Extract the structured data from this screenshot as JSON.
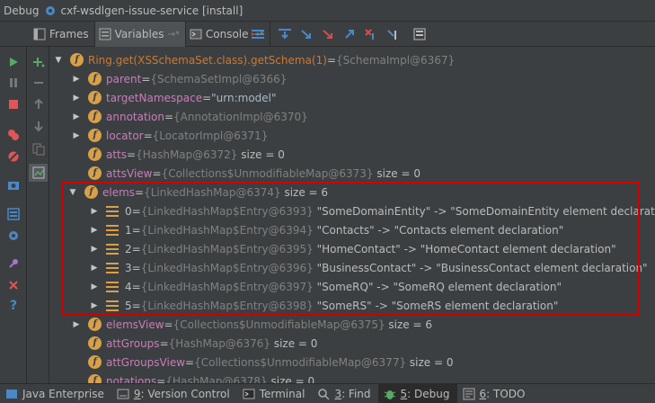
{
  "title": {
    "label": "Debug",
    "config": "cxf-wsdlgen-issue-service [install]"
  },
  "tabs": [
    {
      "label": "Frames"
    },
    {
      "label": "Variables",
      "pin": "→*"
    },
    {
      "label": "Console",
      "pin": "→*"
    }
  ],
  "tree": {
    "root": {
      "name": "Ring.get(XSSchemaSet.class).getSchema(1)",
      "eq": " = ",
      "value": "{SchemaImpl@6367}"
    },
    "fields": [
      {
        "name": "parent",
        "eq": " = ",
        "ref": "{SchemaSetImpl@6366}",
        "extra": ""
      },
      {
        "name": "targetNamespace",
        "eq": " = ",
        "ref": "",
        "extra": "\"urn:model\""
      },
      {
        "name": "annotation",
        "eq": " = ",
        "ref": "{AnnotationImpl@6370}",
        "extra": ""
      },
      {
        "name": "locator",
        "eq": " = ",
        "ref": "{LocatorImpl@6371}",
        "extra": ""
      },
      {
        "name": "atts",
        "eq": " = ",
        "ref": "{HashMap@6372}",
        "extra": "size = 0"
      },
      {
        "name": "attsView",
        "eq": " = ",
        "ref": "{Collections$UnmodifiableMap@6373}",
        "extra": "size = 0"
      },
      {
        "name": "elems",
        "eq": " = ",
        "ref": "{LinkedHashMap@6374}",
        "extra": "size = 6"
      }
    ],
    "entries": [
      {
        "index": "0",
        "ref": "{LinkedHashMap$Entry@6393}",
        "value": "\"SomeDomainEntity\" -> \"SomeDomainEntity element declaration\""
      },
      {
        "index": "1",
        "ref": "{LinkedHashMap$Entry@6394}",
        "value": "\"Contacts\" -> \"Contacts element declaration\""
      },
      {
        "index": "2",
        "ref": "{LinkedHashMap$Entry@6395}",
        "value": "\"HomeContact\" -> \"HomeContact element declaration\""
      },
      {
        "index": "3",
        "ref": "{LinkedHashMap$Entry@6396}",
        "value": "\"BusinessContact\" -> \"BusinessContact element declaration\""
      },
      {
        "index": "4",
        "ref": "{LinkedHashMap$Entry@6397}",
        "value": "\"SomeRQ\" -> \"SomeRQ element declaration\""
      },
      {
        "index": "5",
        "ref": "{LinkedHashMap$Entry@6398}",
        "value": "\"SomeRS\" -> \"SomeRS element declaration\""
      }
    ],
    "after": [
      {
        "name": "elemsView",
        "eq": " = ",
        "ref": "{Collections$UnmodifiableMap@6375}",
        "extra": "size = 6"
      },
      {
        "name": "attGroups",
        "eq": " = ",
        "ref": "{HashMap@6376}",
        "extra": "size = 0"
      },
      {
        "name": "attGroupsView",
        "eq": " = ",
        "ref": "{Collections$UnmodifiableMap@6377}",
        "extra": "size = 0"
      },
      {
        "name": "notations",
        "eq": " = ",
        "ref": "{HashMap@6378}",
        "extra": "size = 0"
      }
    ]
  },
  "status": [
    {
      "key": "",
      "label": "Java Enterprise"
    },
    {
      "key": "9",
      "label": ": Version Control"
    },
    {
      "key": "",
      "label": "Terminal"
    },
    {
      "key": "3",
      "label": ": Find"
    },
    {
      "key": "5",
      "label": ": Debug"
    },
    {
      "key": "6",
      "label": ": TODO"
    }
  ],
  "colors": {
    "background": "#3c3f41",
    "field_name": "#c77dbb",
    "reference": "#808080",
    "highlight_border": "#cc0000",
    "field_icon": "#d7a04a"
  }
}
